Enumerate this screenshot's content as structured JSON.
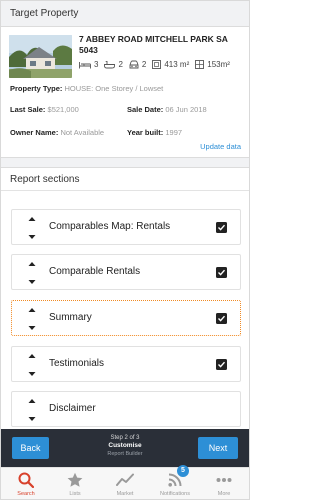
{
  "target_property": {
    "header": "Target Property",
    "address": "7 ABBEY ROAD MITCHELL PARK SA 5043",
    "features": {
      "beds": "3",
      "baths": "2",
      "cars": "2",
      "land": "413 m²",
      "floor": "153m²"
    },
    "property_type_label": "Property Type:",
    "property_type_value": "HOUSE: One Storey / Lowset",
    "last_sale_label": "Last Sale:",
    "last_sale_value": "$521,000",
    "sale_date_label": "Sale Date:",
    "sale_date_value": "06 Jun 2018",
    "owner_name_label": "Owner Name:",
    "owner_name_value": "Not Available",
    "year_built_label": "Year built:",
    "year_built_value": "1997",
    "update_link": "Update data"
  },
  "report_sections": {
    "header": "Report sections",
    "items": [
      {
        "label": "Comparables Map: Rentals",
        "checked": true,
        "selected": false
      },
      {
        "label": "Comparable Rentals",
        "checked": true,
        "selected": false
      },
      {
        "label": "Summary",
        "checked": true,
        "selected": true
      },
      {
        "label": "Testimonials",
        "checked": true,
        "selected": false
      },
      {
        "label": "Disclaimer",
        "checked": false,
        "selected": false
      }
    ]
  },
  "step_bar": {
    "back": "Back",
    "next": "Next",
    "step": "Step 2 of 3",
    "title": "Customise",
    "subtitle": "Report Builder"
  },
  "tabs": [
    {
      "label": "Search",
      "icon": "search-icon",
      "active": true
    },
    {
      "label": "Lists",
      "icon": "star-icon",
      "active": false
    },
    {
      "label": "Market",
      "icon": "trend-icon",
      "active": false
    },
    {
      "label": "Notifications",
      "icon": "rss-icon",
      "active": false,
      "badge": "5"
    },
    {
      "label": "More",
      "icon": "more-icon",
      "active": false
    }
  ],
  "colors": {
    "accent": "#2d8fd6",
    "active_tab": "#d8412b",
    "selected_outline": "#f08a24",
    "step_bar": "#2a2f38"
  }
}
